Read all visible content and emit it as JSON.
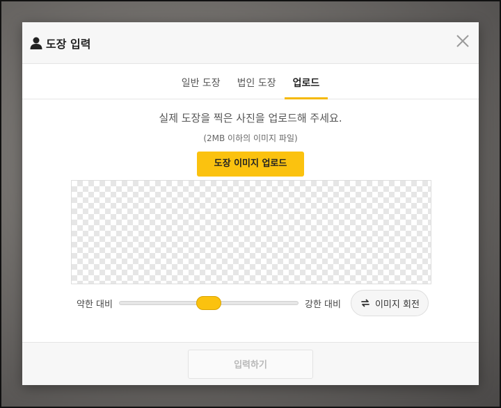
{
  "dialog": {
    "title": "도장 입력",
    "title_icon": "person-icon",
    "close_icon": "close-icon"
  },
  "tabs": [
    {
      "label": "일반 도장",
      "active": false
    },
    {
      "label": "법인 도장",
      "active": false
    },
    {
      "label": "업로드",
      "active": true
    }
  ],
  "upload": {
    "instruction": "실제 도장을 찍은 사진을 업로드해 주세요.",
    "note": "(2MB 이하의 이미지 파일)",
    "button_label": "도장 이미지 업로드"
  },
  "contrast": {
    "low_label": "약한 대비",
    "high_label": "강한 대비",
    "value_fraction": 0.5
  },
  "rotate": {
    "label": "이미지 회전",
    "icon": "rotate-icon"
  },
  "footer": {
    "submit_label": "입력하기",
    "submit_enabled": false
  },
  "colors": {
    "accent": "#fbc20f",
    "tab_underline": "#f5b800"
  }
}
